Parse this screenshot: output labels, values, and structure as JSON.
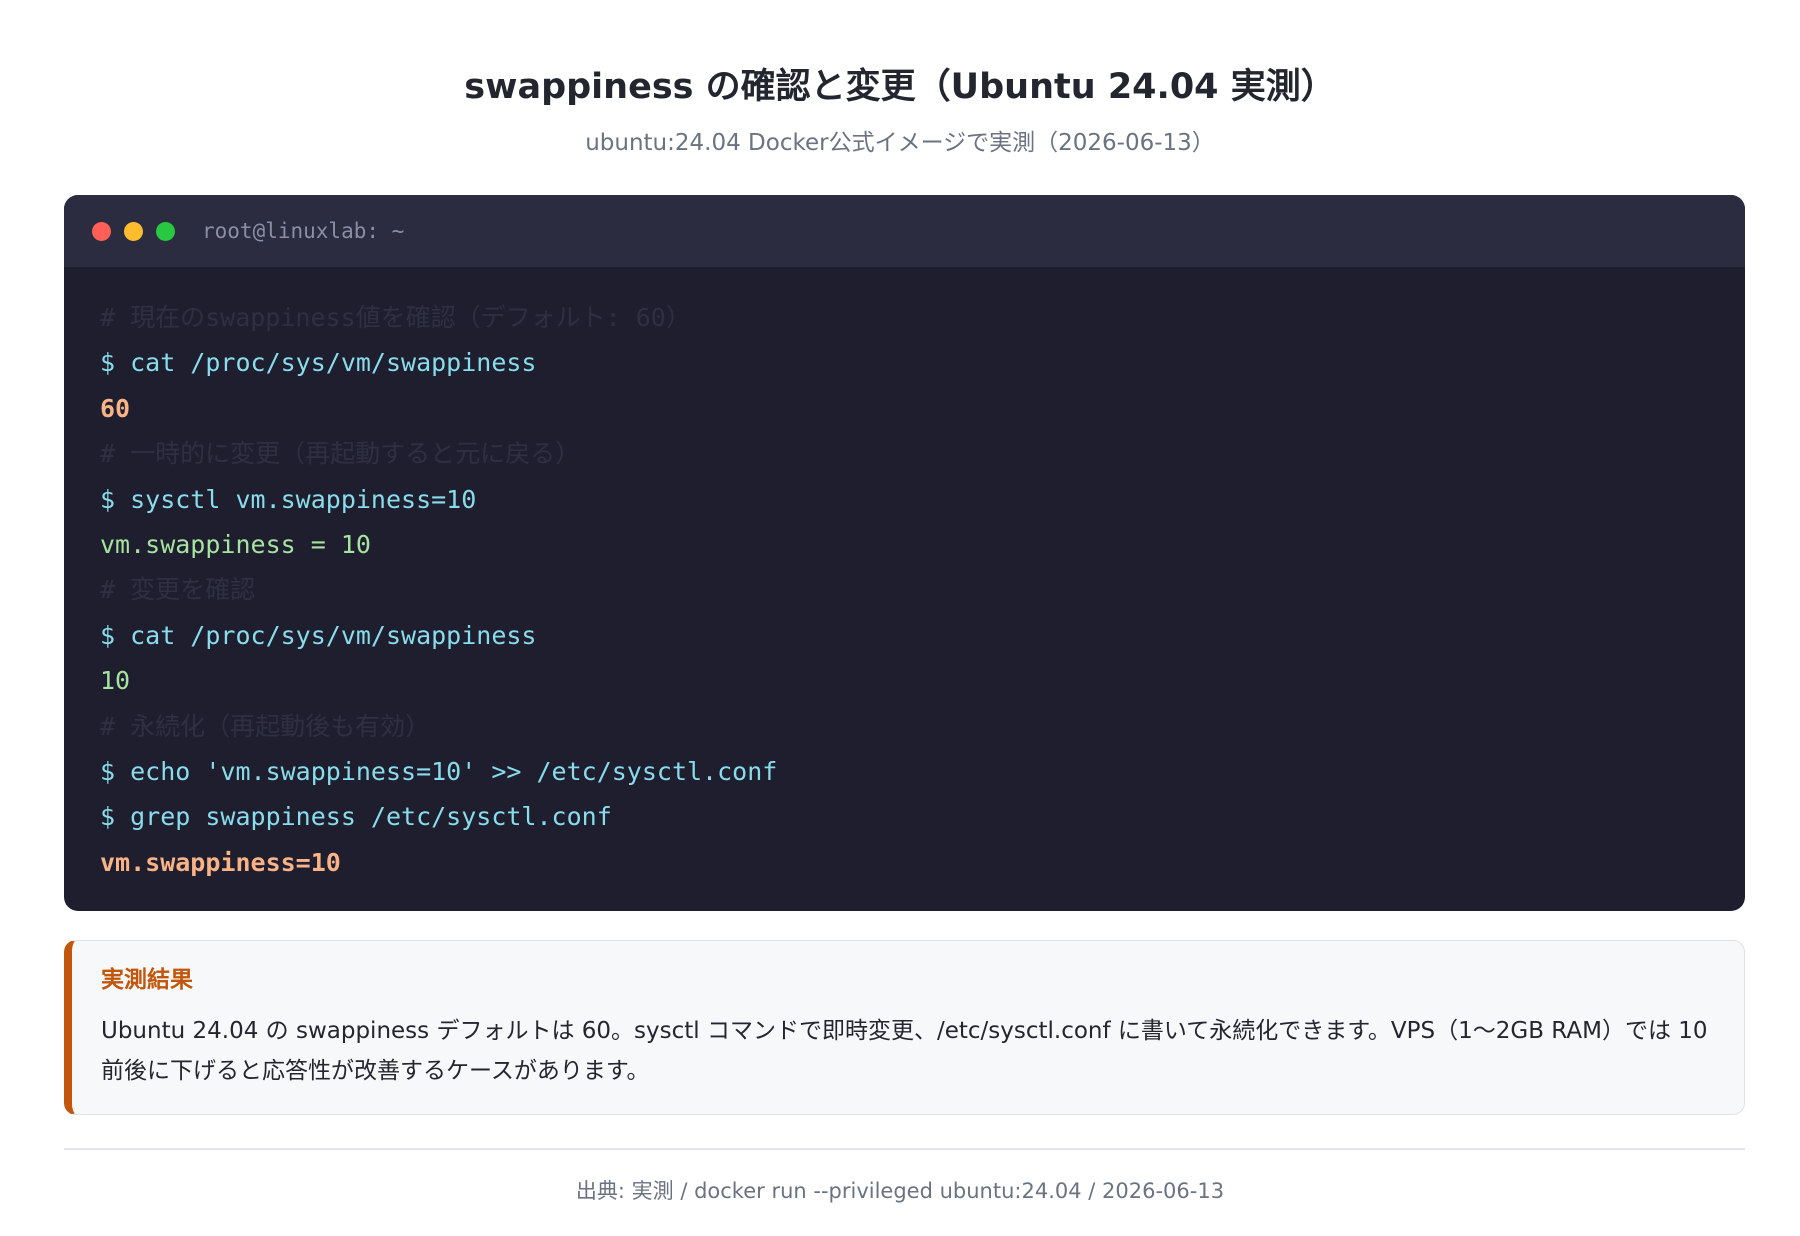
{
  "header": {
    "title": "swappiness の確認と変更（Ubuntu 24.04 実測）",
    "subtitle": "ubuntu:24.04 Docker公式イメージで実測（2026-06-13）"
  },
  "terminal": {
    "window_title": "root@linuxlab: ~",
    "window_controls": [
      "close-dot",
      "minimize-dot",
      "maximize-dot"
    ],
    "lines": [
      {
        "kind": "comment",
        "text": "# 現在のswappiness値を確認（デフォルト: 60）"
      },
      {
        "kind": "cmd",
        "text": "$ cat /proc/sys/vm/swappiness"
      },
      {
        "kind": "out-orange",
        "text": "60"
      },
      {
        "kind": "comment",
        "text": "# 一時的に変更（再起動すると元に戻る）"
      },
      {
        "kind": "cmd",
        "text": "$ sysctl vm.swappiness=10"
      },
      {
        "kind": "out-green",
        "text": "vm.swappiness = 10"
      },
      {
        "kind": "comment",
        "text": "# 変更を確認"
      },
      {
        "kind": "cmd",
        "text": "$ cat /proc/sys/vm/swappiness"
      },
      {
        "kind": "out-green",
        "text": "10"
      },
      {
        "kind": "comment",
        "text": "# 永続化（再起動後も有効）"
      },
      {
        "kind": "cmd",
        "text": "$ echo 'vm.swappiness=10' >> /etc/sysctl.conf"
      },
      {
        "kind": "cmd",
        "text": "$ grep swappiness /etc/sysctl.conf"
      },
      {
        "kind": "out-orange",
        "text": "vm.swappiness=10"
      }
    ]
  },
  "callout": {
    "title": "実測結果",
    "text": "Ubuntu 24.04 の swappiness デフォルトは 60。sysctl コマンドで即時変更、/etc/sysctl.conf に書いて永続化できます。VPS（1〜2GB RAM）では 10 前後に下げると応答性が改善するケースがあります。"
  },
  "footer": {
    "source": "出典: 実測 / docker run --privileged ubuntu:24.04 / 2026-06-13"
  },
  "colors": {
    "terminal_bg": "#1e1e2e",
    "command": "#89dceb",
    "output_orange": "#fab387",
    "output_green": "#a6e3a1",
    "accent": "#c2570c"
  }
}
